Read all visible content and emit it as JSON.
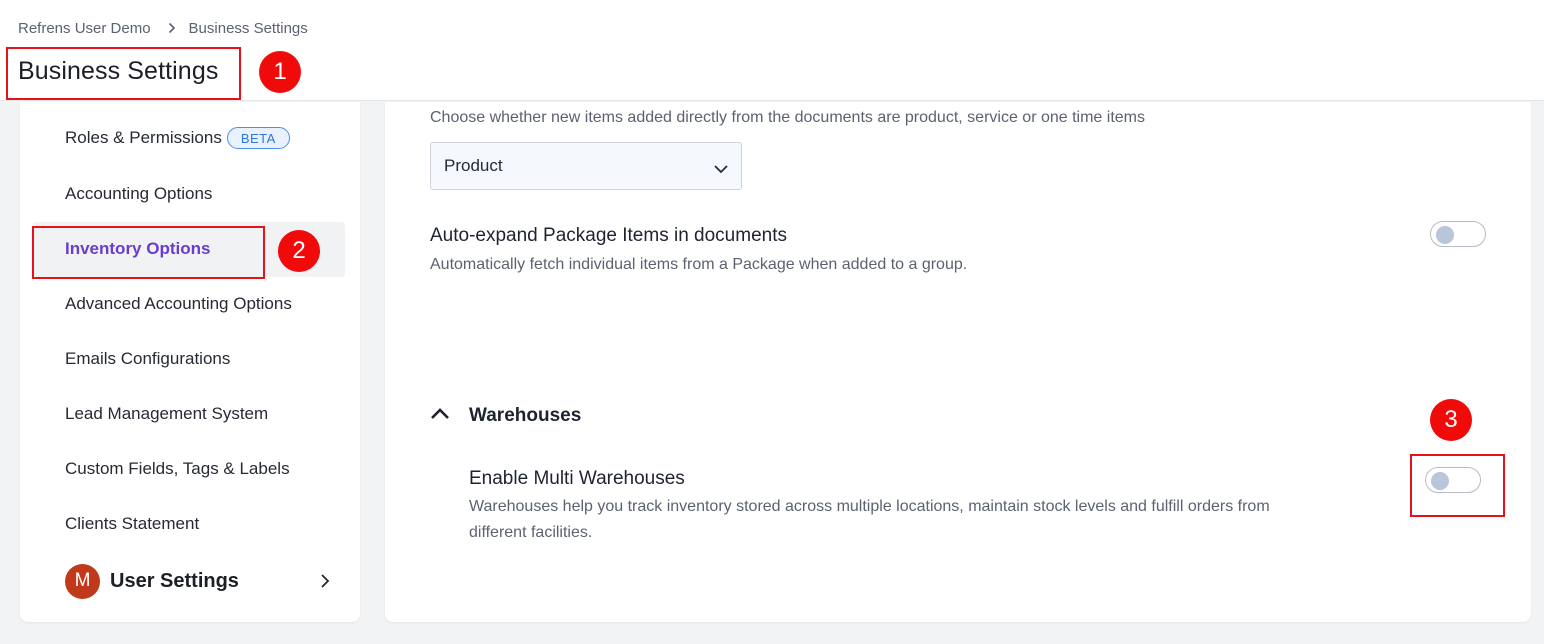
{
  "breadcrumb": {
    "root": "Refrens User Demo",
    "current": "Business Settings"
  },
  "page": {
    "title": "Business Settings"
  },
  "annotations": {
    "badge1": "1",
    "badge2": "2",
    "badge3": "3"
  },
  "sidebar": {
    "items": [
      {
        "label": "Roles & Permissions",
        "badge": "BETA"
      },
      {
        "label": "Accounting Options"
      },
      {
        "label": "Inventory Options",
        "active": true
      },
      {
        "label": "Advanced Accounting Options"
      },
      {
        "label": "Emails Configurations"
      },
      {
        "label": "Lead Management System"
      },
      {
        "label": "Custom Fields, Tags & Labels"
      },
      {
        "label": "Clients Statement"
      }
    ],
    "user_settings": {
      "avatar_letter": "M",
      "label": "User Settings"
    }
  },
  "main": {
    "item_type_desc": "Choose whether new items added directly from the documents are product, service or one time items",
    "item_type_select": {
      "value": "Product"
    },
    "auto_expand": {
      "title": "Auto-expand Package Items in documents",
      "desc": "Automatically fetch individual items from a Package when added to a group.",
      "enabled": false
    },
    "warehouses": {
      "section_label": "Warehouses",
      "title": "Enable Multi Warehouses",
      "desc_line1": "Warehouses help you track inventory stored across multiple locations, maintain stock levels and fulfill orders from",
      "desc_line2": "different facilities.",
      "enabled": false
    }
  },
  "colors": {
    "accent": "#6b3ccf",
    "annotation": "#e3121b",
    "beta": "#2f76d6"
  }
}
